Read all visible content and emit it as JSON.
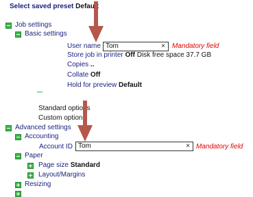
{
  "header": {
    "label": "Select saved preset",
    "value": "Default"
  },
  "job_settings": {
    "label": "Job settings",
    "basic": {
      "label": "Basic settings",
      "user_name_label": "User name",
      "user_name_value": "Tom",
      "clear_glyph": "×",
      "mandatory": "Mandatory field",
      "store_job_label": "Store job in printer",
      "store_job_value": "Off",
      "disk_free": "Disk free space 37.7 GB",
      "copies_label": "Copies",
      "copies_value": "..",
      "collate_label": "Collate",
      "collate_value": "Off",
      "hold_label": "Hold for preview",
      "hold_value": "Default"
    },
    "standard_options": "Standard options",
    "custom_options": "Custom options"
  },
  "advanced": {
    "label": "Advanced settings",
    "accounting": {
      "label": "Accounting",
      "account_id_label": "Account ID",
      "account_id_value": "Tom",
      "clear_glyph": "×",
      "mandatory": "Mandatory field"
    },
    "paper": {
      "label": "Paper",
      "page_size_label": "Page size",
      "page_size_value": "Standard",
      "layout_label": "Layout/Margins"
    },
    "resizing_label": "Resizing"
  },
  "colors": {
    "arrow": "#b5574a",
    "link": "#1a237e",
    "toggle": "#3cb44a",
    "mandatory": "#e00000"
  }
}
